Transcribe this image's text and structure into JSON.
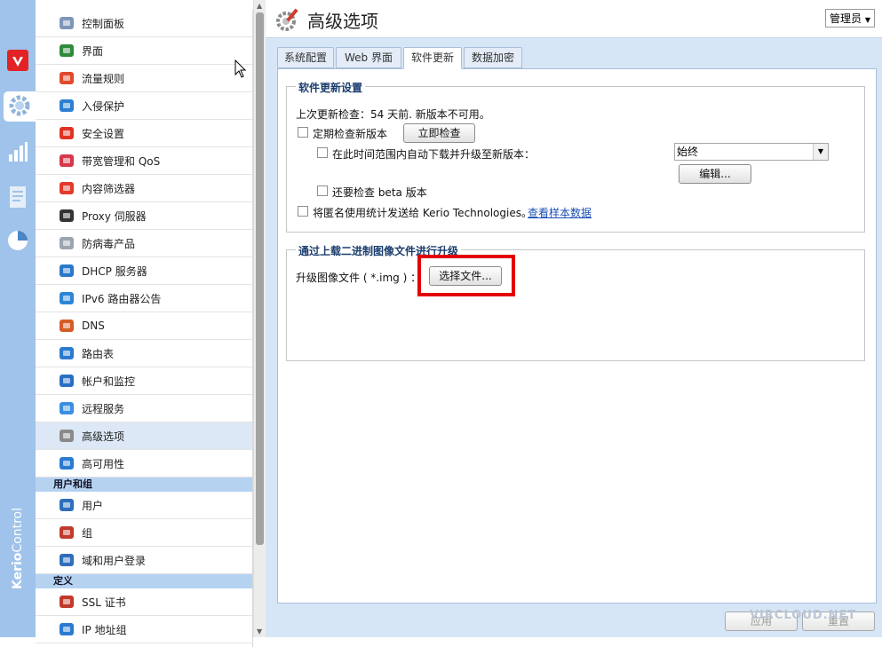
{
  "brand": {
    "bold": "Kerio",
    "thin": "Control"
  },
  "nav": {
    "items": [
      {
        "label": "控制面板",
        "icon": "dashboard-icon"
      },
      {
        "label": "界面",
        "icon": "interfaces-icon"
      },
      {
        "label": "流量规则",
        "icon": "traffic-rules-icon"
      },
      {
        "label": "入侵保护",
        "icon": "shield-icon"
      },
      {
        "label": "安全设置",
        "icon": "stop-hand-icon"
      },
      {
        "label": "带宽管理和 QoS",
        "icon": "bandwidth-icon"
      },
      {
        "label": "内容筛选器",
        "icon": "funnel-icon"
      },
      {
        "label": "Proxy 伺服器",
        "icon": "proxy-icon"
      },
      {
        "label": "防病毒产品",
        "icon": "syringe-icon"
      },
      {
        "label": "DHCP 服务器",
        "icon": "dhcp-icon"
      },
      {
        "label": "IPv6 路由器公告",
        "icon": "ipv6-icon"
      },
      {
        "label": "DNS",
        "icon": "dns-icon"
      },
      {
        "label": "路由表",
        "icon": "routing-icon"
      },
      {
        "label": "帐户和监控",
        "icon": "accounting-icon"
      },
      {
        "label": "远程服务",
        "icon": "cloud-icon"
      },
      {
        "label": "高级选项",
        "icon": "advanced-gear-icon",
        "selected": true
      },
      {
        "label": "高可用性",
        "icon": "high-availability-icon"
      }
    ],
    "section_users": "用户和组",
    "users_items": [
      {
        "label": "用户",
        "icon": "user-icon"
      },
      {
        "label": "组",
        "icon": "group-icon"
      },
      {
        "label": "域和用户登录",
        "icon": "domain-login-icon"
      }
    ],
    "section_defs": "定义",
    "defs_items": [
      {
        "label": "SSL 证书",
        "icon": "certificate-icon"
      },
      {
        "label": "IP 地址组",
        "icon": "ip-group-icon"
      }
    ]
  },
  "header": {
    "title": "高级选项",
    "admin": "管理员"
  },
  "tabs": [
    {
      "label": "系统配置"
    },
    {
      "label": "Web 界面"
    },
    {
      "label": "软件更新",
      "active": true
    },
    {
      "label": "数据加密"
    }
  ],
  "update": {
    "legend": "软件更新设置",
    "last_check": "上次更新检查：54 天前. 新版本不可用。",
    "periodic_check": "定期检查新版本",
    "check_now": "立即检查",
    "auto_download": "在此时间范围内自动下载并升级至新版本：",
    "time_range_value": "始终",
    "edit_button": "编辑...",
    "beta_check": "还要检查 beta 版本",
    "anon_stats": "将匿名使用统计发送给 Kerio Technologies。",
    "sample_link": "查看样本数据"
  },
  "upload": {
    "legend": "通过上载二进制图像文件进行升级",
    "file_label": "升级图像文件 ( *.img ) ：",
    "choose_file": "选择文件..."
  },
  "footer": {
    "apply": "应用",
    "reset": "重置"
  },
  "watermark": "VIRCLOUD.NET",
  "colors": {
    "rail": "#9fc3ea",
    "accent": "#e30000",
    "link": "#1c4fb4",
    "bg": "#d7e6f7"
  }
}
